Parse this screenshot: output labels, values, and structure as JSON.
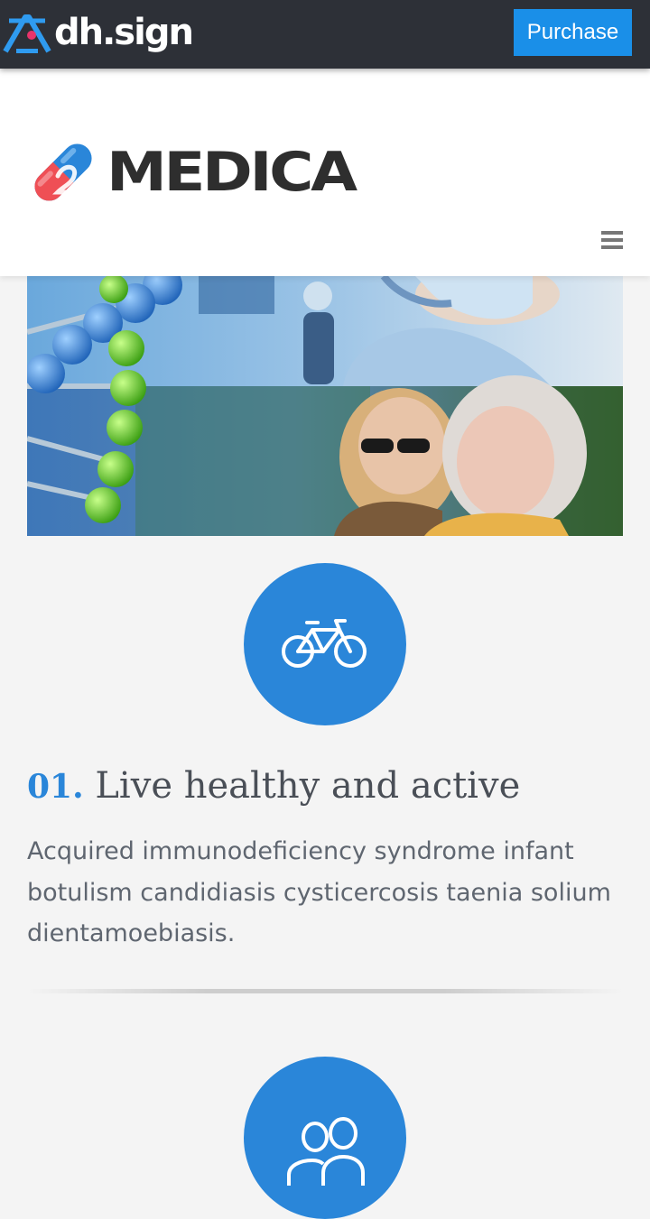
{
  "topbar": {
    "brand": "dh.sign",
    "purchase_label": "Purchase"
  },
  "header": {
    "logo_text": "MEDICA",
    "menu_icon": "hamburger-menu-icon"
  },
  "hero": {
    "image_description_icon": "hero-image"
  },
  "features": [
    {
      "icon": "bicycle-icon",
      "number": "01.",
      "title": "Live healthy and active",
      "description": "Acquired immunodeficiency syndrome infant botulism candidiasis cysticercosis taenia solium dientamoebiasis."
    },
    {
      "icon": "users-icon"
    }
  ],
  "colors": {
    "topbar_bg": "#2d3037",
    "purchase_btn": "#1a8fe8",
    "accent_blue": "#2a86d9",
    "page_bg": "#f4f4f4",
    "text_dark": "#4a4f57",
    "text_body": "#5f6670"
  }
}
